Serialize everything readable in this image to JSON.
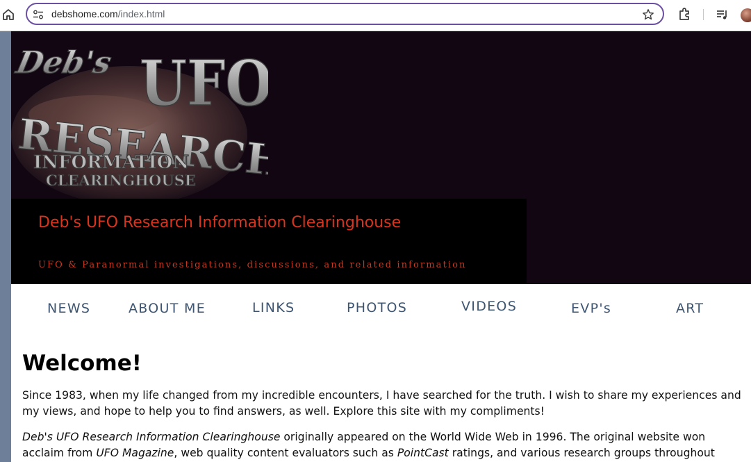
{
  "browser": {
    "url_domain": "debshome.com",
    "url_path": "/index.html",
    "icons": [
      "home-icon",
      "site-settings-icon",
      "bookmark-star-icon",
      "extensions-icon",
      "media-controls-icon",
      "profile-avatar"
    ]
  },
  "header": {
    "logo_text": [
      "Deb's",
      "UFO",
      "RESEARCH",
      "INFORMATION",
      "CLEARINGHOUSE"
    ],
    "site_title": "Deb's UFO Research Information Clearinghouse",
    "tagline": "UFO & Paranormal investigations, discussions, and related information"
  },
  "nav": {
    "items": [
      "NEWS",
      "ABOUT ME",
      "LINKS",
      "PHOTOS",
      "VIDEOS",
      "EVP's",
      "ART"
    ]
  },
  "main": {
    "heading": "Welcome!",
    "para1": "Since 1983, when my life changed from my incredible encounters, I have searched for the truth. I wish to share my experiences and my views, and hope to help you to find answers, as well. Explore this site with my compliments!",
    "para2_italic1": "Deb's UFO Research Information Clearinghouse",
    "para2_text1": " originally appeared on the World Wide Web in 1996. The original website won acclaim from ",
    "para2_italic2": "UFO Magazine",
    "para2_text2": ", web quality content evaluators such as ",
    "para2_italic3": "PointCast",
    "para2_text3": " ratings, and various research groups throughout"
  },
  "colors": {
    "accent_border": "#6b4fa0",
    "title_red": "#d8351f",
    "nav_text": "#3e5572",
    "banner_bg": "#110612",
    "left_strip": "#6e8099"
  }
}
